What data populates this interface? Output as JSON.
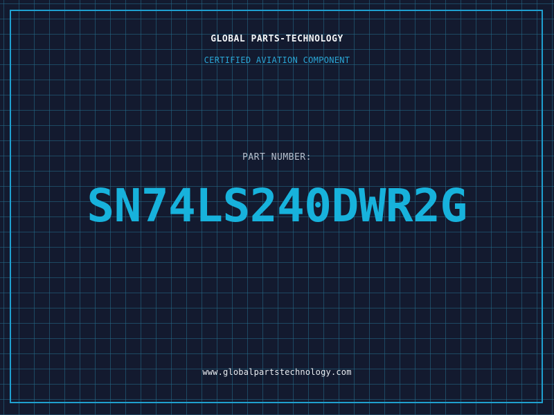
{
  "header": {
    "brand": "GLOBAL PARTS-TECHNOLOGY",
    "tagline": "CERTIFIED AVIATION COMPONENT"
  },
  "main": {
    "part_label": "PART NUMBER:",
    "part_number": "SN74LS240DWR2G"
  },
  "footer": {
    "website": "www.globalpartstechnology.com"
  },
  "colors": {
    "background": "#131a2f",
    "grid": "#246e8c",
    "frame": "#1fa0d0",
    "accent": "#17b2dc"
  }
}
